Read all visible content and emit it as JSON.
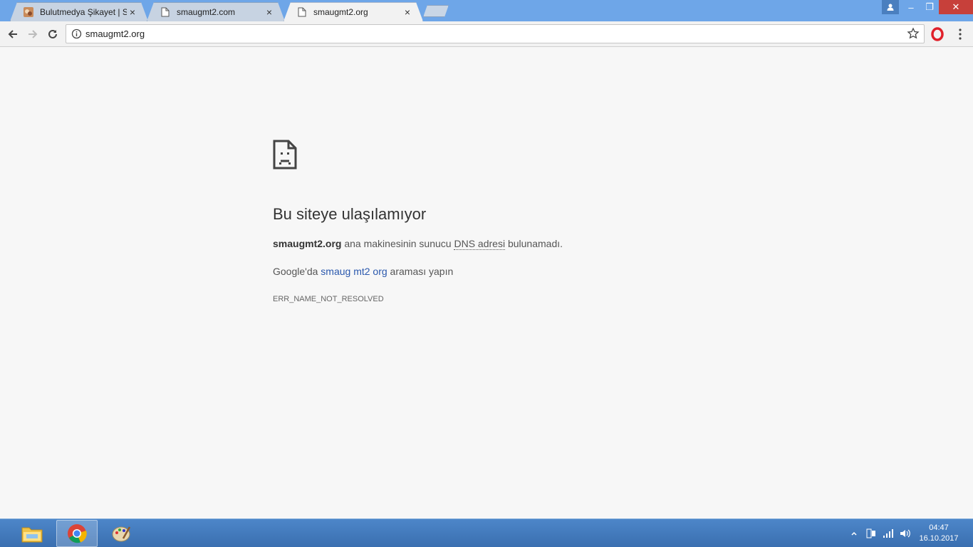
{
  "tabs": [
    {
      "title": "Bulutmedya Şikayet | Say",
      "close": "×",
      "favicon": "bulutmedya-icon"
    },
    {
      "title": "smaugmt2.com",
      "close": "×",
      "favicon": "page-icon"
    },
    {
      "title": "smaugmt2.org",
      "close": "×",
      "favicon": "page-icon",
      "active": true
    }
  ],
  "window_controls": {
    "minimize": "–",
    "maximize": "❐",
    "close": "✕"
  },
  "omnibox": {
    "url": "smaugmt2.org"
  },
  "error": {
    "title": "Bu siteye ulaşılamıyor",
    "host": "smaugmt2.org",
    "desc_mid": " ana makinesinin sunucu ",
    "desc_abbr": "DNS adresi",
    "desc_end": " bulunamadı.",
    "suggest_prefix": "Google'da ",
    "suggest_link": "smaug mt2 org",
    "suggest_suffix": " araması yapın",
    "code": "ERR_NAME_NOT_RESOLVED"
  },
  "taskbar": {
    "items": [
      "file-explorer-icon",
      "chrome-icon",
      "paint-icon"
    ],
    "clock_time": "04:47",
    "clock_date": "16.10.2017"
  },
  "colors": {
    "accent_link": "#2a58ad",
    "titlebar": "#6ea6e8",
    "taskbar": "#3a6fb0"
  }
}
